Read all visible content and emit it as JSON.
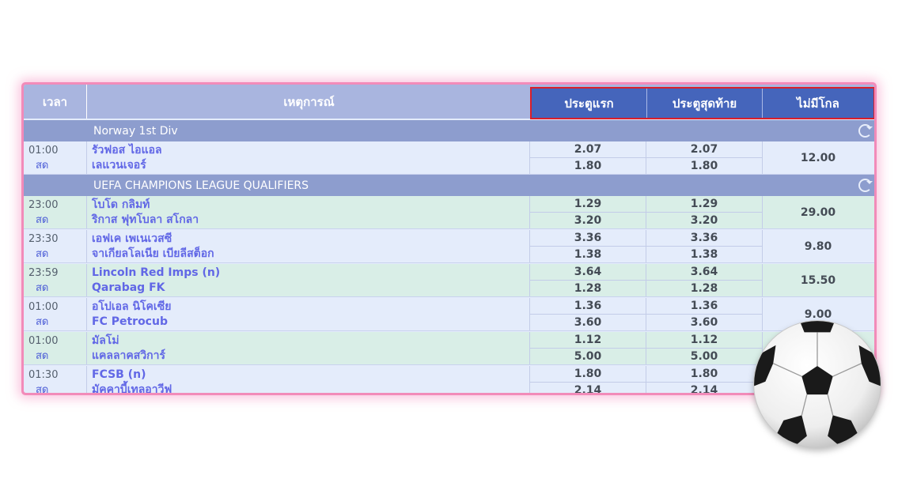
{
  "header": {
    "time": "เวลา",
    "event": "เหตุการณ์",
    "first_goal": "ประตูแรก",
    "last_goal": "ประตูสุดท้าย",
    "no_goal": "ไม่มีโกล"
  },
  "leagues": [
    {
      "name": "Norway 1st Div",
      "matches": [
        {
          "time": "01:00",
          "status": "สด",
          "home": "รัวฟอส ไอแอล",
          "away": "เลแวนเจอร์",
          "first": [
            "2.07",
            "1.80"
          ],
          "last": [
            "2.07",
            "1.80"
          ],
          "nogoal": "12.00"
        }
      ]
    },
    {
      "name": "UEFA CHAMPIONS LEAGUE QUALIFIERS",
      "matches": [
        {
          "time": "23:00",
          "status": "สด",
          "home": "โบโด กลิมท์",
          "away": "ริกาส ฟุทโบลา สโกลา",
          "first": [
            "1.29",
            "3.20"
          ],
          "last": [
            "1.29",
            "3.20"
          ],
          "nogoal": "29.00"
        },
        {
          "time": "23:30",
          "status": "สด",
          "home": "เอฟเค เพเนเวสซี",
          "away": "จาเกียลโลเนีย เบียลีสต็อก",
          "first": [
            "3.36",
            "1.38"
          ],
          "last": [
            "3.36",
            "1.38"
          ],
          "nogoal": "9.80"
        },
        {
          "time": "23:59",
          "status": "สด",
          "home": "Lincoln Red Imps (n)",
          "away": "Qarabag FK",
          "first": [
            "3.64",
            "1.28"
          ],
          "last": [
            "3.64",
            "1.28"
          ],
          "nogoal": "15.50"
        },
        {
          "time": "01:00",
          "status": "สด",
          "home": "อโปเอล นิโคเซีย",
          "away": "FC Petrocub",
          "first": [
            "1.36",
            "3.60"
          ],
          "last": [
            "1.36",
            "3.60"
          ],
          "nogoal": "9.00"
        },
        {
          "time": "01:00",
          "status": "สด",
          "home": "มัลโม่",
          "away": "แคลลาคสวิการ์",
          "first": [
            "1.12",
            "5.00"
          ],
          "last": [
            "1.12",
            "5.00"
          ],
          "nogoal": ""
        },
        {
          "time": "01:30",
          "status": "สด",
          "home": "FCSB (n)",
          "away": "มัคคาบี้เทลอาวีฟ",
          "first": [
            "1.80",
            "2.14"
          ],
          "last": [
            "1.80",
            "2.14"
          ],
          "nogoal": ""
        }
      ]
    }
  ],
  "icons": {
    "refresh": "refresh-icon",
    "ball": "soccer-ball-icon"
  },
  "colors": {
    "header_blue": "#4565bb",
    "highlight": "#d91f2a",
    "team_text": "#6167e6",
    "border_glow": "#f28bb9"
  }
}
